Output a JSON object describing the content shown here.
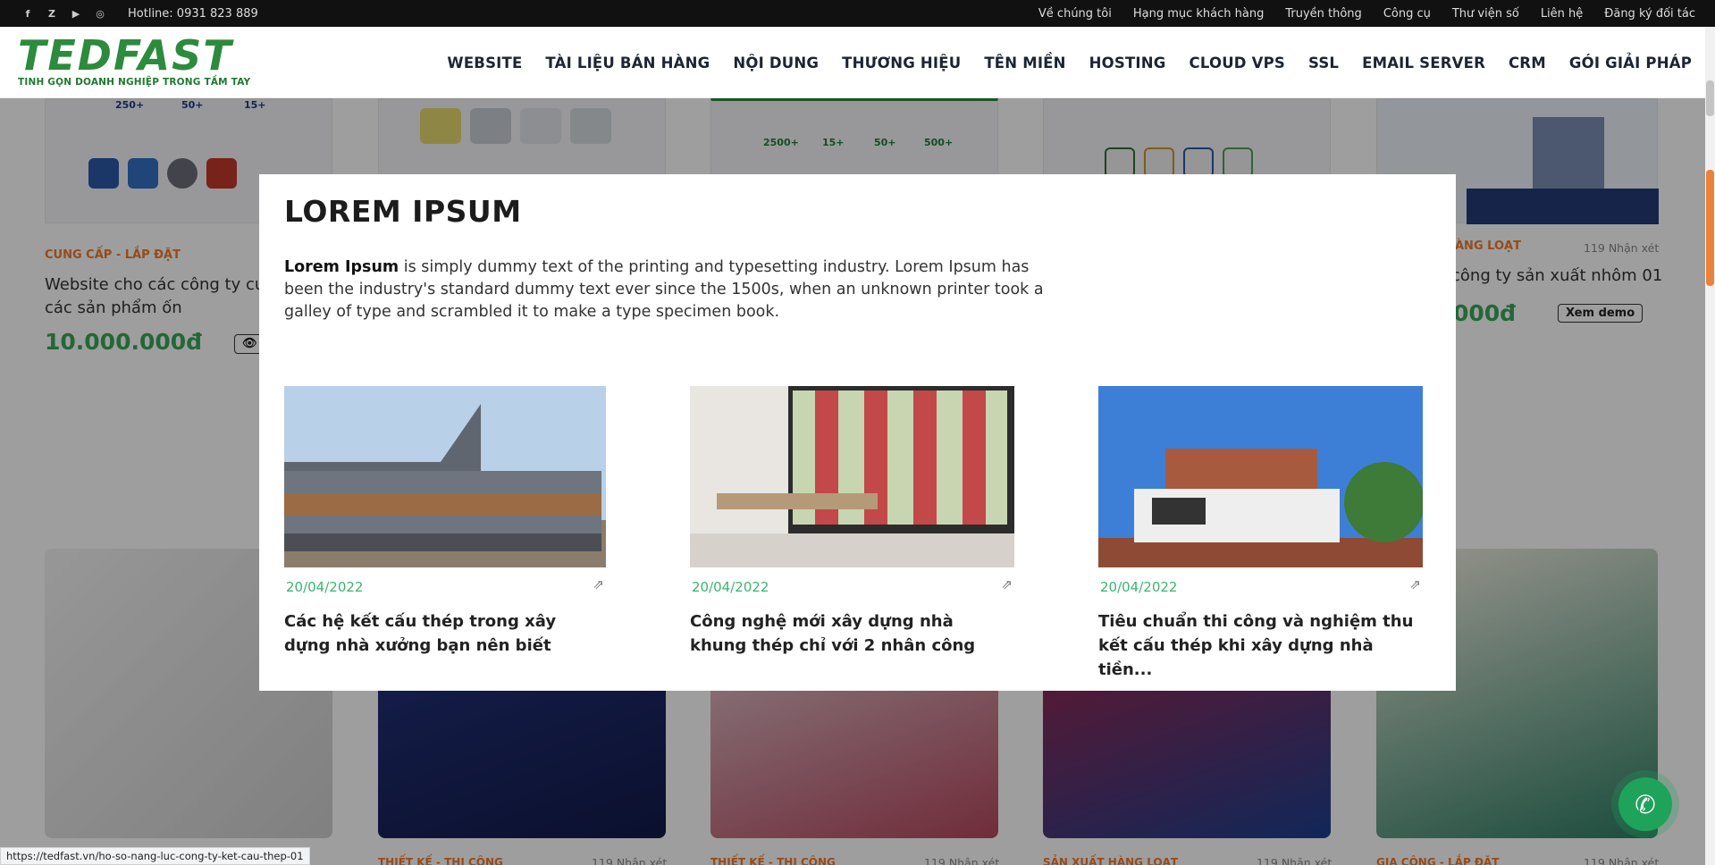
{
  "topbar": {
    "socials": [
      "f",
      "Z",
      "▶",
      "◎"
    ],
    "hotline": "Hotline: 0931 823 889",
    "links": [
      "Về chúng tôi",
      "Hạng mục khách hàng",
      "Truyền thông",
      "Công cụ",
      "Thư viện số",
      "Liên hệ",
      "Đăng ký đối tác"
    ]
  },
  "logo": {
    "word": "TEDFAST",
    "tagline": "TINH GỌN DOANH NGHIỆP TRONG TẦM TAY"
  },
  "nav": [
    "WEBSITE",
    "TÀI LIỆU BÁN HÀNG",
    "NỘI DUNG",
    "THƯƠNG HIỆU",
    "TÊN MIỀN",
    "HOSTING",
    "CLOUD VPS",
    "SSL",
    "EMAIL SERVER",
    "CRM",
    "GÓI GIẢI PHÁP"
  ],
  "cards_top": [
    {
      "category": "CUNG CẤP - LẮP ĐẶT",
      "title": "Website cho các công ty cung cấp các sản phẩm ốn",
      "price": "10.000.000đ"
    },
    {
      "category": "ÀNG LOẠT",
      "reviews": "119 Nhận xét",
      "title": "công ty sản xuất nhôm 01",
      "price": "000đ",
      "demo": "Xem demo"
    }
  ],
  "cards_bottom": [
    {
      "category": "THIẾT KẾ - THI CÔNG",
      "reviews": "119 Nhận xét"
    },
    {
      "category": "THIẾT KẾ - THI CÔNG",
      "reviews": "119 Nhận xét"
    },
    {
      "category": "SẢN XUẤT HÀNG LOẠT",
      "reviews": "119 Nhận xét"
    },
    {
      "category": "GIA CÔNG - LẮP ĐẶT",
      "reviews": "119 Nhận xét"
    }
  ],
  "mini_stats": [
    "250+",
    "50+",
    "15+",
    "2500+",
    "15+",
    "50+",
    "500+"
  ],
  "modal": {
    "title": "LOREM IPSUM",
    "desc_bold": "Lorem Ipsum",
    "desc_rest": " is simply dummy text of the printing and typesetting industry. Lorem Ipsum has been the industry's standard dummy text ever since the 1500s, when an unknown printer took a galley of type and scrambled it to make a type specimen book.",
    "posts": [
      {
        "date": "20/04/2022",
        "title": "Các hệ kết cấu thép trong xây dựng nhà xưởng bạn nên biết"
      },
      {
        "date": "20/04/2022",
        "title": "Công nghệ mới xây dựng nhà khung thép chỉ với 2 nhân công"
      },
      {
        "date": "20/04/2022",
        "title": "Tiêu chuẩn thi công và nghiệm thu kết cấu thép khi xây dựng nhà tiền..."
      }
    ]
  },
  "status_url": "https://tedfast.vn/ho-so-nang-luc-cong-ty-ket-cau-thep-01",
  "colors": {
    "brand_green": "#2c8b3c",
    "accent_orange": "#f07a2b",
    "price_green": "#3aa65a",
    "date_green": "#3cb371"
  }
}
